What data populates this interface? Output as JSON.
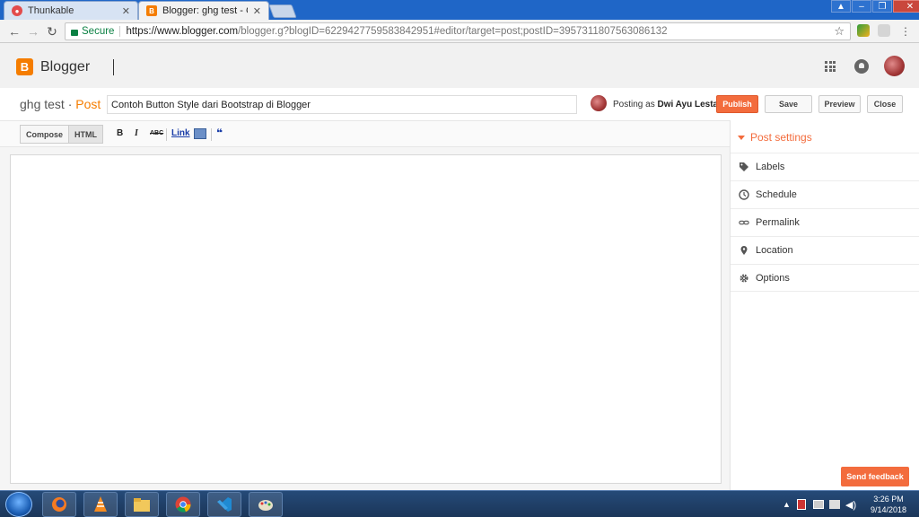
{
  "browser": {
    "tabs": [
      {
        "title": "Thunkable",
        "active": false
      },
      {
        "title": "Blogger: ghg test - Create",
        "active": true
      }
    ],
    "address": {
      "secure_label": "Secure",
      "url_host": "https://www.blogger.com",
      "url_path": "/blogger.g?blogID=6229427759583842951#editor/target=post;postID=3957311807563086132"
    }
  },
  "header": {
    "logo_letter": "B",
    "app_name": "Blogger"
  },
  "post": {
    "blog_name": "ghg test",
    "separator": "·",
    "post_type": "Post",
    "title_value": "Contoh Button Style dari Bootstrap di Blogger",
    "posting_as_label": "Posting as",
    "author": "Dwi Ayu Lestari",
    "buttons": {
      "publish": "Publish",
      "save": "Save",
      "preview": "Preview",
      "close": "Close"
    }
  },
  "toolbar": {
    "compose": "Compose",
    "html": "HTML",
    "bold": "B",
    "italic": "I",
    "strike": "ABC",
    "link": "Link",
    "quote": "❝"
  },
  "sidebar": {
    "header": "Post settings",
    "items": [
      {
        "label": "Labels",
        "icon": "tag-icon"
      },
      {
        "label": "Schedule",
        "icon": "clock-icon"
      },
      {
        "label": "Permalink",
        "icon": "link-icon"
      },
      {
        "label": "Location",
        "icon": "location-pin-icon"
      },
      {
        "label": "Options",
        "icon": "gear-icon"
      }
    ]
  },
  "feedback_label": "Send feedback",
  "taskbar": {
    "time": "3:26 PM",
    "date": "9/14/2018"
  },
  "colors": {
    "accent": "#f36c3d",
    "blogger_orange": "#f57d00",
    "secure_green": "#0b8043"
  }
}
